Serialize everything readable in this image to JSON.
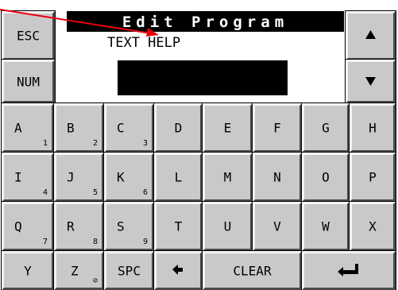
{
  "screen": {
    "title": "Edit Program",
    "subtitle": "TEXT HELP",
    "input_value": ""
  },
  "side_keys": {
    "esc": "ESC",
    "num": "NUM"
  },
  "nav_icons": {
    "up": "up-arrow-icon",
    "down": "down-arrow-icon"
  },
  "keyboard": {
    "row1": [
      {
        "label": "A",
        "sub": "1"
      },
      {
        "label": "B",
        "sub": "2"
      },
      {
        "label": "C",
        "sub": "3"
      },
      {
        "label": "D",
        "sub": ""
      },
      {
        "label": "E",
        "sub": ""
      },
      {
        "label": "F",
        "sub": ""
      },
      {
        "label": "G",
        "sub": ""
      },
      {
        "label": "H",
        "sub": ""
      }
    ],
    "row2": [
      {
        "label": "I",
        "sub": "4"
      },
      {
        "label": "J",
        "sub": "5"
      },
      {
        "label": "K",
        "sub": "6"
      },
      {
        "label": "L",
        "sub": ""
      },
      {
        "label": "M",
        "sub": ""
      },
      {
        "label": "N",
        "sub": ""
      },
      {
        "label": "O",
        "sub": ""
      },
      {
        "label": "P",
        "sub": ""
      }
    ],
    "row3": [
      {
        "label": "Q",
        "sub": "7"
      },
      {
        "label": "R",
        "sub": "8"
      },
      {
        "label": "S",
        "sub": "9"
      },
      {
        "label": "T",
        "sub": ""
      },
      {
        "label": "U",
        "sub": ""
      },
      {
        "label": "V",
        "sub": ""
      },
      {
        "label": "W",
        "sub": ""
      },
      {
        "label": "X",
        "sub": ""
      }
    ],
    "row4": {
      "y": {
        "label": "Y"
      },
      "z": {
        "label": "Z",
        "sub": "⊘"
      },
      "spc": {
        "label": "SPC"
      },
      "backspace_icon": "left-arrow-icon",
      "clear": {
        "label": "CLEAR"
      },
      "enter_icon": "enter-return-icon"
    }
  },
  "colors": {
    "key_face": "#c9c9c9",
    "display_bg": "#000000",
    "annotation_arrow": "#e8000b"
  }
}
